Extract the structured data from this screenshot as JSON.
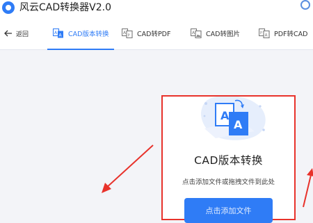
{
  "app": {
    "title": "风云CAD转换器V2.0"
  },
  "nav": {
    "back_label": "返回",
    "tabs": [
      {
        "label": "CAD版本转换",
        "icon": "convert-version-icon",
        "active": true
      },
      {
        "label": "CAD转PDF",
        "icon": "cad-to-pdf-icon",
        "active": false
      },
      {
        "label": "CAD转图片",
        "icon": "cad-to-image-icon",
        "active": false
      },
      {
        "label": "PDF转CAD",
        "icon": "pdf-to-cad-icon",
        "active": false
      }
    ]
  },
  "card": {
    "title": "CAD版本转换",
    "hint": "点击添加文件或拖拽文件到此处",
    "button_label": "点击添加文件"
  },
  "colors": {
    "accent": "#2f7cf6",
    "highlight_border": "#e8322b",
    "arrow": "#e8322b",
    "page_background": "#f3f4f8"
  }
}
